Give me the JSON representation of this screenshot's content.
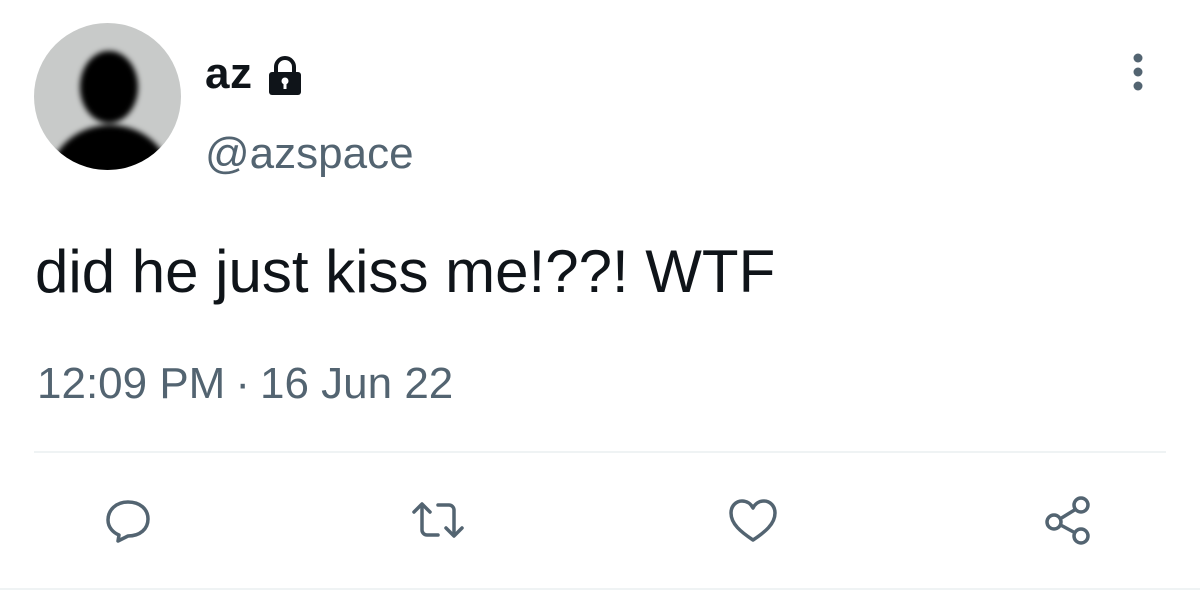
{
  "tweet": {
    "author": {
      "display_name": "az",
      "handle": "@azspace",
      "protected_icon": "lock-icon",
      "avatar_icon": "default-avatar-silhouette"
    },
    "text": "did he just kiss me!??! WTF",
    "time": "12:09 PM",
    "separator": "·",
    "date": "16 Jun 22",
    "menu_icon": "more-vertical-icon"
  },
  "actions": [
    {
      "name": "reply",
      "icon": "reply-icon"
    },
    {
      "name": "retweet",
      "icon": "retweet-icon"
    },
    {
      "name": "like",
      "icon": "heart-icon"
    },
    {
      "name": "share",
      "icon": "share-icon"
    }
  ],
  "colors": {
    "primary_text": "#0f1419",
    "secondary_text": "#536471",
    "divider": "#eff3f4",
    "avatar_background": "#c8cac9"
  }
}
